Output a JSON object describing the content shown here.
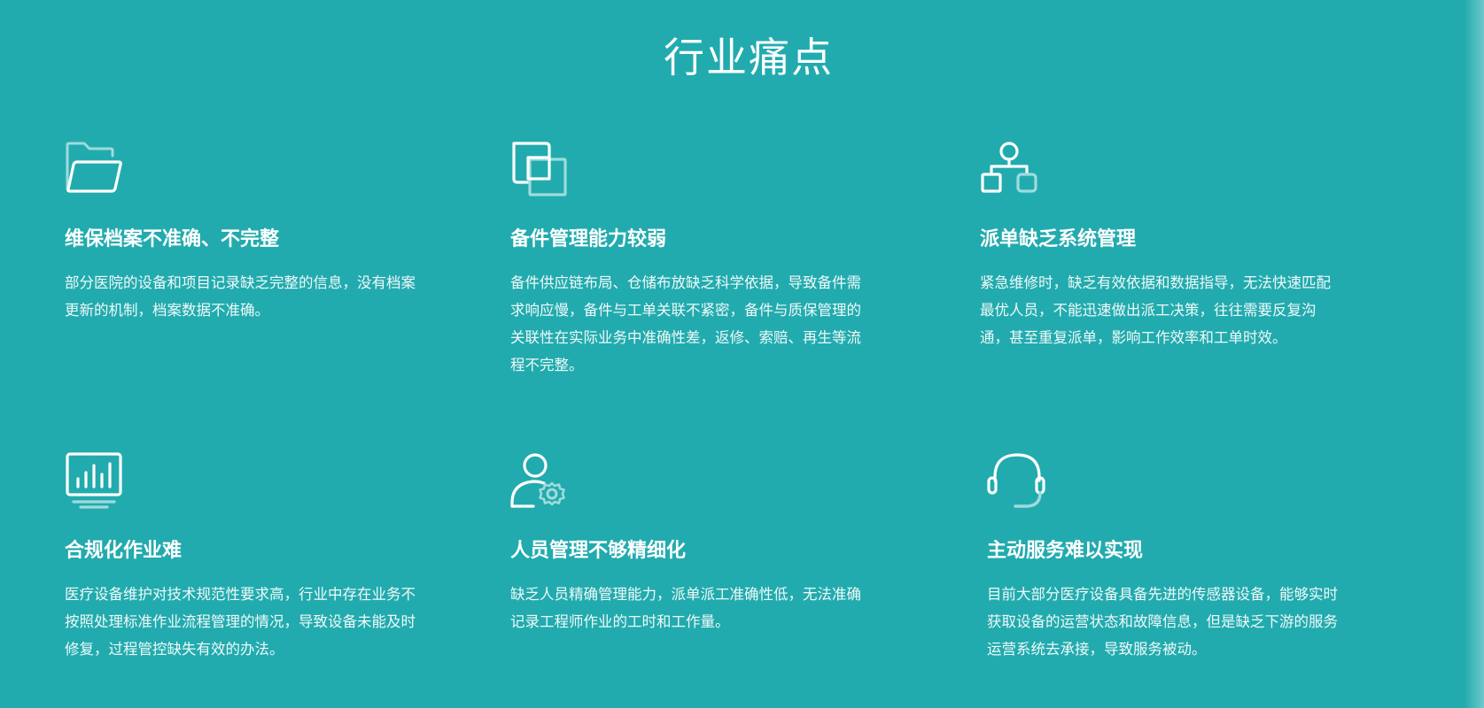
{
  "section": {
    "title": "行业痛点"
  },
  "colors": {
    "background": "#22abae",
    "text": "#ffffff",
    "icon_accent": "#9fdbdc"
  },
  "cards": [
    {
      "icon": "folder-icon",
      "title": "维保档案不准确、不完整",
      "text": "部分医院的设备和项目记录缺乏完整的信息，没有档案更新的机制，档案数据不准确。"
    },
    {
      "icon": "copy-squares-icon",
      "title": "备件管理能力较弱",
      "text": "备件供应链布局、仓储布放缺乏科学依据，导致备件需求响应慢，备件与工单关联不紧密，备件与质保管理的关联性在实际业务中准确性差，返修、索赔、再生等流程不完整。"
    },
    {
      "icon": "hierarchy-icon",
      "title": "派单缺乏系统管理",
      "text": "紧急维修时，缺乏有效依据和数据指导，无法快速匹配最优人员，不能迅速做出派工决策，往往需要反复沟通，甚至重复派单，影响工作效率和工单时效。"
    },
    {
      "icon": "monitor-chart-icon",
      "title": "合规化作业难",
      "text": "医疗设备维护对技术规范性要求高，行业中存在业务不按照处理标准作业流程管理的情况，导致设备未能及时修复，过程管控缺失有效的办法。"
    },
    {
      "icon": "user-gear-icon",
      "title": "人员管理不够精细化",
      "text": "缺乏人员精确管理能力，派单派工准确性低，无法准确记录工程师作业的工时和工作量。"
    },
    {
      "icon": "headset-icon",
      "title": "主动服务难以实现",
      "text": "目前大部分医疗设备具备先进的传感器设备，能够实时获取设备的运营状态和故障信息，但是缺乏下游的服务运营系统去承接，导致服务被动。"
    }
  ]
}
